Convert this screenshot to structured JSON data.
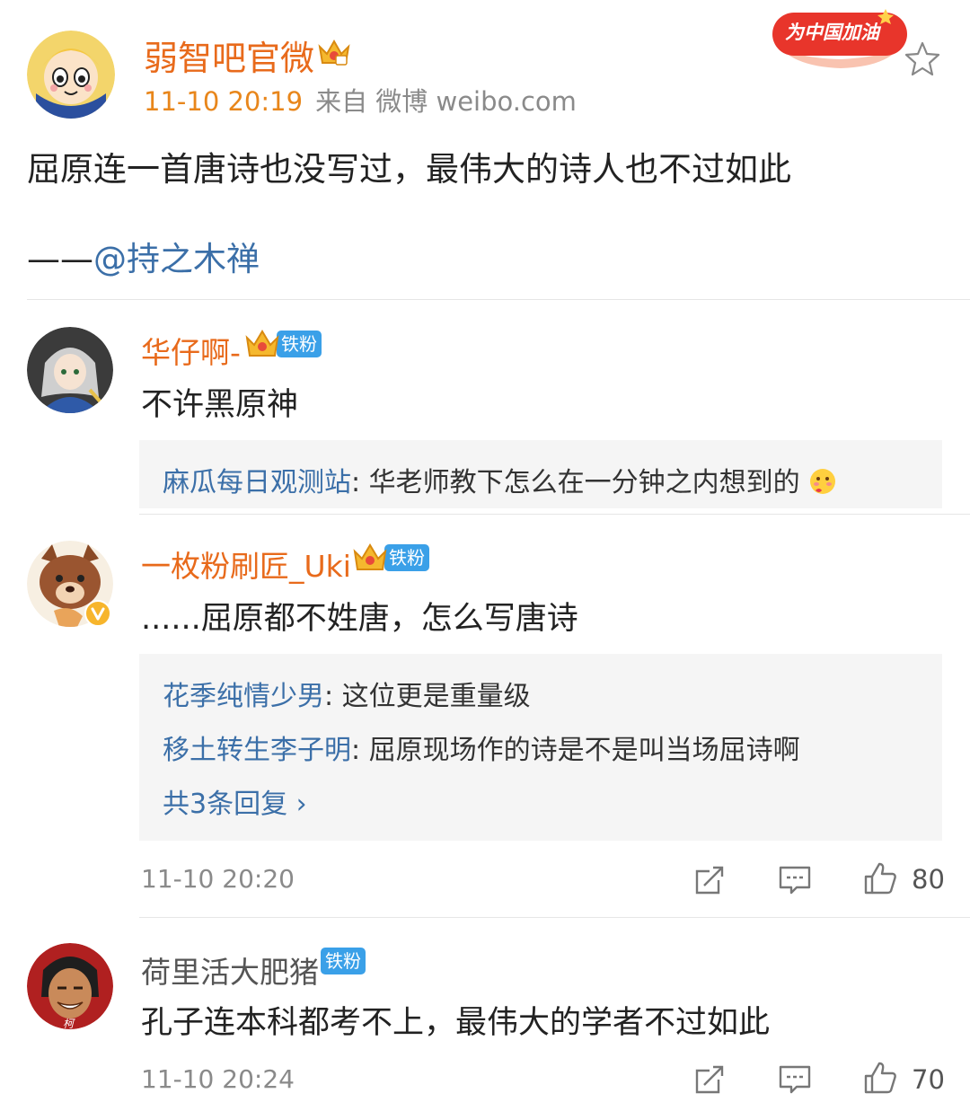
{
  "post": {
    "author": "弱智吧官微",
    "time": "11-10 20:19",
    "source": "来自 微博 weibo.com",
    "campaign_text": "为中国加油",
    "text": "屈原连一首唐诗也没写过，最伟大的诗人也不过如此",
    "sign_dash": "——",
    "sign_mention": "@持之木禅"
  },
  "comments": [
    {
      "name": "华仔啊-",
      "badge": "铁粉",
      "text": "不许黑原神",
      "replies": [
        {
          "name": "麻瓜每日观测站",
          "sep": ": ",
          "text": "华老师教下怎么在一分钟之内想到的"
        }
      ]
    },
    {
      "name": "一枚粉刷匠_Uki",
      "badge": "铁粉",
      "text": "......屈原都不姓唐，怎么写唐诗",
      "replies": [
        {
          "name": "花季纯情少男",
          "sep": ": ",
          "text": "这位更是重量级"
        },
        {
          "name": "移土转生李子明",
          "sep": ": ",
          "text": "屈原现场作的诗是不是叫当场屈诗啊"
        }
      ],
      "more_replies": "共3条回复 ›",
      "time": "11-10 20:20",
      "likes": "80"
    },
    {
      "name": "荷里活大肥猪",
      "badge": "铁粉",
      "text": "孔子连本科都考不上，最伟大的学者不过如此",
      "time": "11-10 20:24",
      "likes": "70"
    }
  ],
  "icons": [
    "crown-icon",
    "star-icon",
    "share-icon",
    "comment-icon",
    "like-icon",
    "blush-emoji-icon",
    "verified-icon"
  ],
  "colors": {
    "orange_name": "#e86a1b",
    "link_blue": "#3b6fa8",
    "badge_blue": "#3aa0e8",
    "reply_bg": "#f5f5f5"
  }
}
